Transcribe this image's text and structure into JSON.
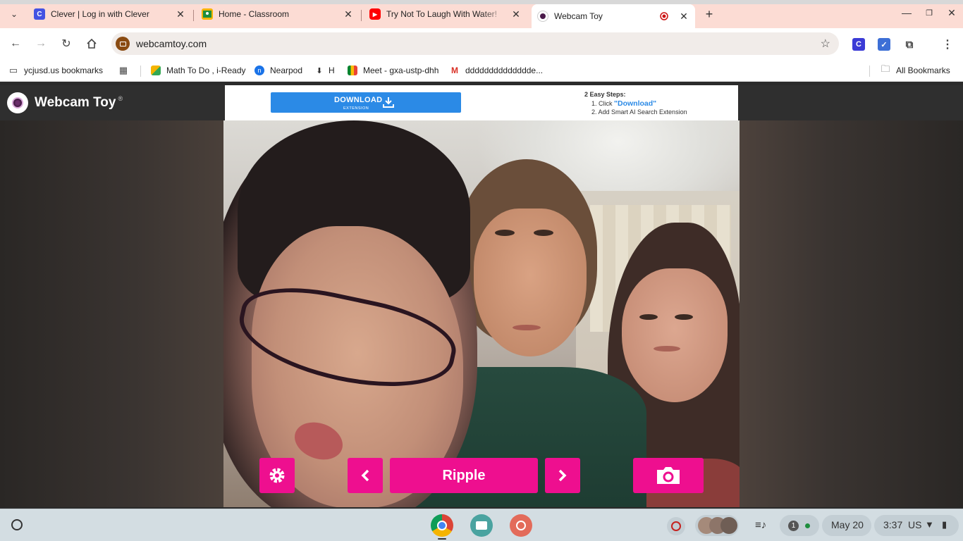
{
  "browser": {
    "tabs": [
      {
        "title": "Clever | Log in with Clever",
        "icon": "clever-icon",
        "color": "#4352e2",
        "glyph": "C",
        "active": false
      },
      {
        "title": "Home - Classroom",
        "icon": "classroom-icon",
        "color": "#f5b400",
        "glyph": "",
        "active": false
      },
      {
        "title": "Try Not To Laugh With Water!",
        "icon": "youtube-icon",
        "color": "#ff0000",
        "glyph": "▶",
        "active": false
      },
      {
        "title": "Webcam Toy",
        "icon": "webcamtoy-icon",
        "color": "#4a1a4a",
        "glyph": "",
        "active": true
      }
    ],
    "url": "webcamtoy.com",
    "bookmarks": [
      {
        "label": "ycjusd.us bookmarks",
        "icon": "managed-folder-icon"
      },
      {
        "label": "Math To Do , i-Ready",
        "icon": "iready-icon"
      },
      {
        "label": "Nearpod",
        "icon": "nearpod-icon"
      },
      {
        "label": "H",
        "icon": "download-icon"
      },
      {
        "label": "Meet - gxa-ustp-dhh",
        "icon": "meet-icon"
      },
      {
        "label": "dddddddddddddde...",
        "icon": "gmail-icon"
      }
    ],
    "all_bookmarks": "All Bookmarks"
  },
  "page": {
    "brand": "Webcam Toy",
    "brand_mark": "®",
    "ad": {
      "button_main": "DOWNLOAD",
      "button_sub": "EXTENSION",
      "steps_title": "2 Easy Steps:",
      "step1_prefix": "1. Click ",
      "step1_link": "\"Download\"",
      "step2": "2. Add Smart AI Search Extension"
    },
    "effect_name": "Ripple",
    "colors": {
      "accent": "#ee0f8f",
      "ad_blue": "#2b8ae6"
    }
  },
  "shelf": {
    "date": "May 20",
    "time": "3:37",
    "locale": "US",
    "notification_count": "1"
  }
}
